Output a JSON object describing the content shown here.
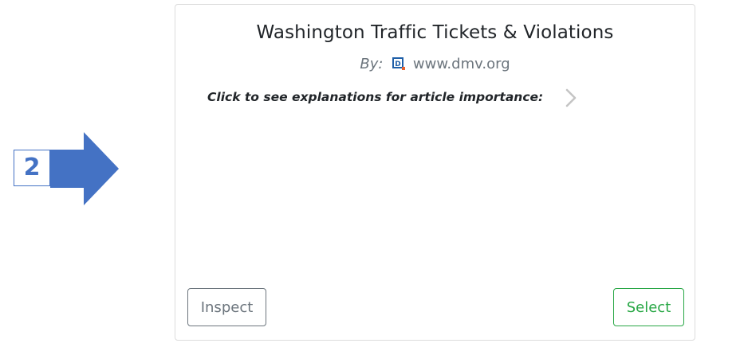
{
  "step_marker": {
    "number": "2",
    "color": "#4472c4"
  },
  "card": {
    "title": "Washington Traffic Tickets & Violations",
    "byline_prefix": "By:",
    "source": "www.dmv.org",
    "favicon_icon": "dmv-favicon-icon",
    "explain_label": "Click to see explanations for article importance:",
    "expand_icon": "chevron-right-icon",
    "inspect_label": "Inspect",
    "select_label": "Select",
    "colors": {
      "inspect": "#6c757d",
      "select": "#28a745",
      "border": "#dcdcdc"
    }
  }
}
